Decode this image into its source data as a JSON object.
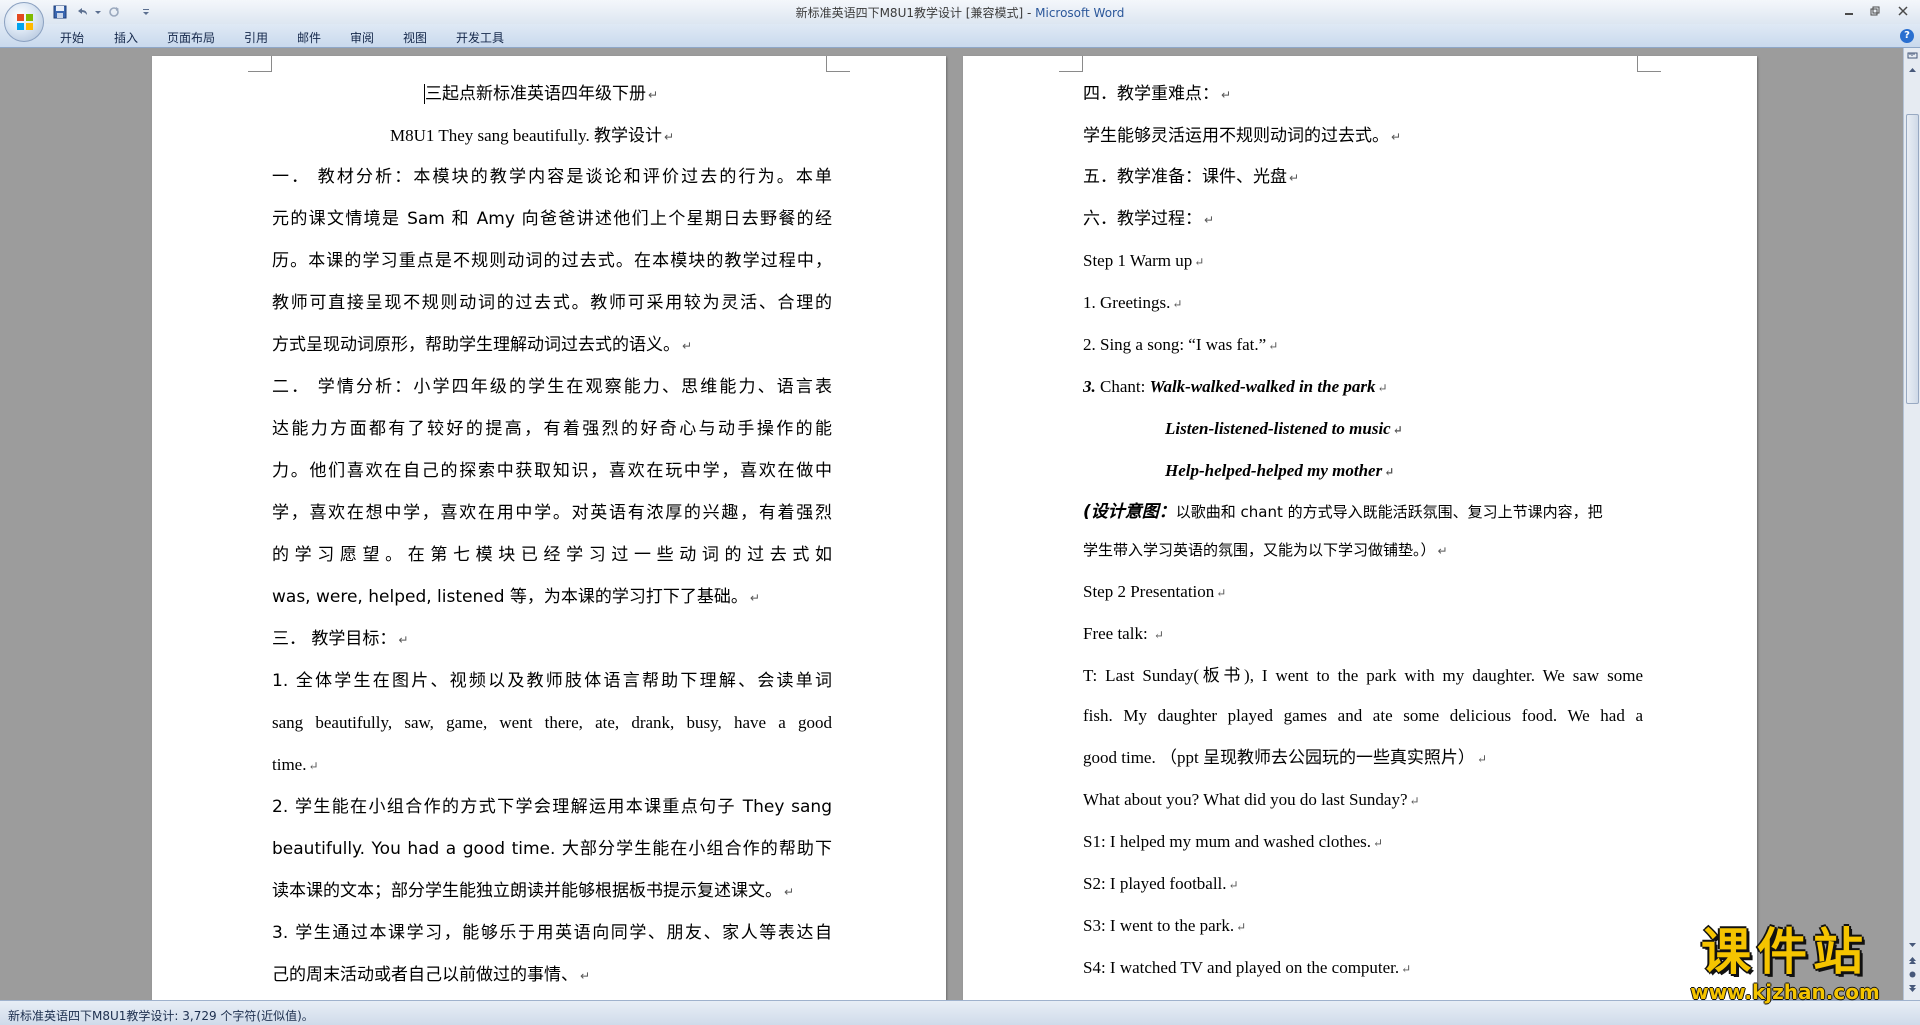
{
  "window": {
    "title": "新标准英语四下M8U1教学设计 [兼容模式] - ",
    "app_name": "Microsoft Word"
  },
  "ribbon": {
    "tabs": [
      "开始",
      "插入",
      "页面布局",
      "引用",
      "邮件",
      "审阅",
      "视图",
      "开发工具"
    ]
  },
  "status": {
    "text": "新标准英语四下M8U1教学设计: 3,729 个字符(近似值)。"
  },
  "watermark": {
    "main": "课件站",
    "sub": "www.kjzhan.com"
  },
  "left_page": {
    "line_title": "三起点新标准英语四年级下册",
    "line_subtitle": "M8U1 They sang beautifully.  教学设计",
    "s1_l1": "一．  教材分析：本模块的教学内容是谈论和评价过去的行为。本单",
    "s1_l2": "元的课文情境是 Sam 和 Amy 向爸爸讲述他们上个星期日去野餐的经",
    "s1_l3": "历。本课的学习重点是不规则动词的过去式。在本模块的教学过程中，",
    "s1_l4": "教师可直接呈现不规则动词的过去式。教师可采用较为灵活、合理的",
    "s1_l5": "方式呈现动词原形，帮助学生理解动词过去式的语义。",
    "s2_l1": "二．  学情分析：小学四年级的学生在观察能力、思维能力、语言表",
    "s2_l2": "达能力方面都有了较好的提高，有着强烈的好奇心与动手操作的能",
    "s2_l3": "力。他们喜欢在自己的探索中获取知识，喜欢在玩中学，喜欢在做中",
    "s2_l4": "学，喜欢在想中学，喜欢在用中学。对英语有浓厚的兴趣，有着强烈",
    "s2_l5": "的学习愿望。在第七模块已经学习过一些动词的过去式如",
    "s2_l6": "was, were, helped, listened 等，为本课的学习打下了基础。",
    "s3_head": "三．  教学目标：",
    "g1_l1": "1. 全体学生在图片、视频以及教师肢体语言帮助下理解、会读单词",
    "g1_l2": "sang beautifully, saw, game, went there, ate, drank, busy, have a good",
    "g1_l3": "time.",
    "g2_l1": "2. 学生能在小组合作的方式下学会理解运用本课重点句子 They sang",
    "g2_l2": "beautifully. You had a good time.  大部分学生能在小组合作的帮助下",
    "g2_l3": "读本课的文本；部分学生能独立朗读并能够根据板书提示复述课文。",
    "g3_l1": "3. 学生通过本课学习，能够乐于用英语向同学、朋友、家人等表达自",
    "g3_l2": "己的周末活动或者自己以前做过的事情、"
  },
  "right_page": {
    "h4": "四．教学重难点：",
    "p4": "学生能够灵活运用不规则动词的过去式。",
    "h5": "五．教学准备：课件、光盘",
    "h6": "六．教学过程：",
    "step1": "Step 1 Warm up",
    "item1": "1. Greetings.",
    "item2": "2. Sing a song: “I was fat.”",
    "item3_num": "3.",
    "item3_label": " Chant: ",
    "chant1": "Walk-walked-walked in the park",
    "chant2": "Listen-listened-listened to music",
    "chant3": "Help-helped-helped my mother",
    "intent_label": "(设计意图：",
    "intent_l1": "以歌曲和 chant 的方式导入既能活跃氛围、复习上节课内容，把",
    "intent_l2": "学生带入学习英语的氛围，又能为以下学习做铺垫。）",
    "step2": "Step 2 Presentation",
    "free_talk": "Free talk: ",
    "t_l1": "T: Last Sunday(板书), I went to the park with my daughter. We saw some",
    "t_l2": "fish. My daughter played games and ate some delicious food. We had a",
    "t_l3": "good time. （ppt 呈现教师去公园玩的一些真实照片）",
    "q": "What about you? What did you do last Sunday?",
    "s1": "S1: I helped my mum and washed clothes.",
    "s2": "S2: I played football.",
    "s3": "S3: I went to the park.",
    "s4": "S4: I watched TV and played on the computer."
  }
}
